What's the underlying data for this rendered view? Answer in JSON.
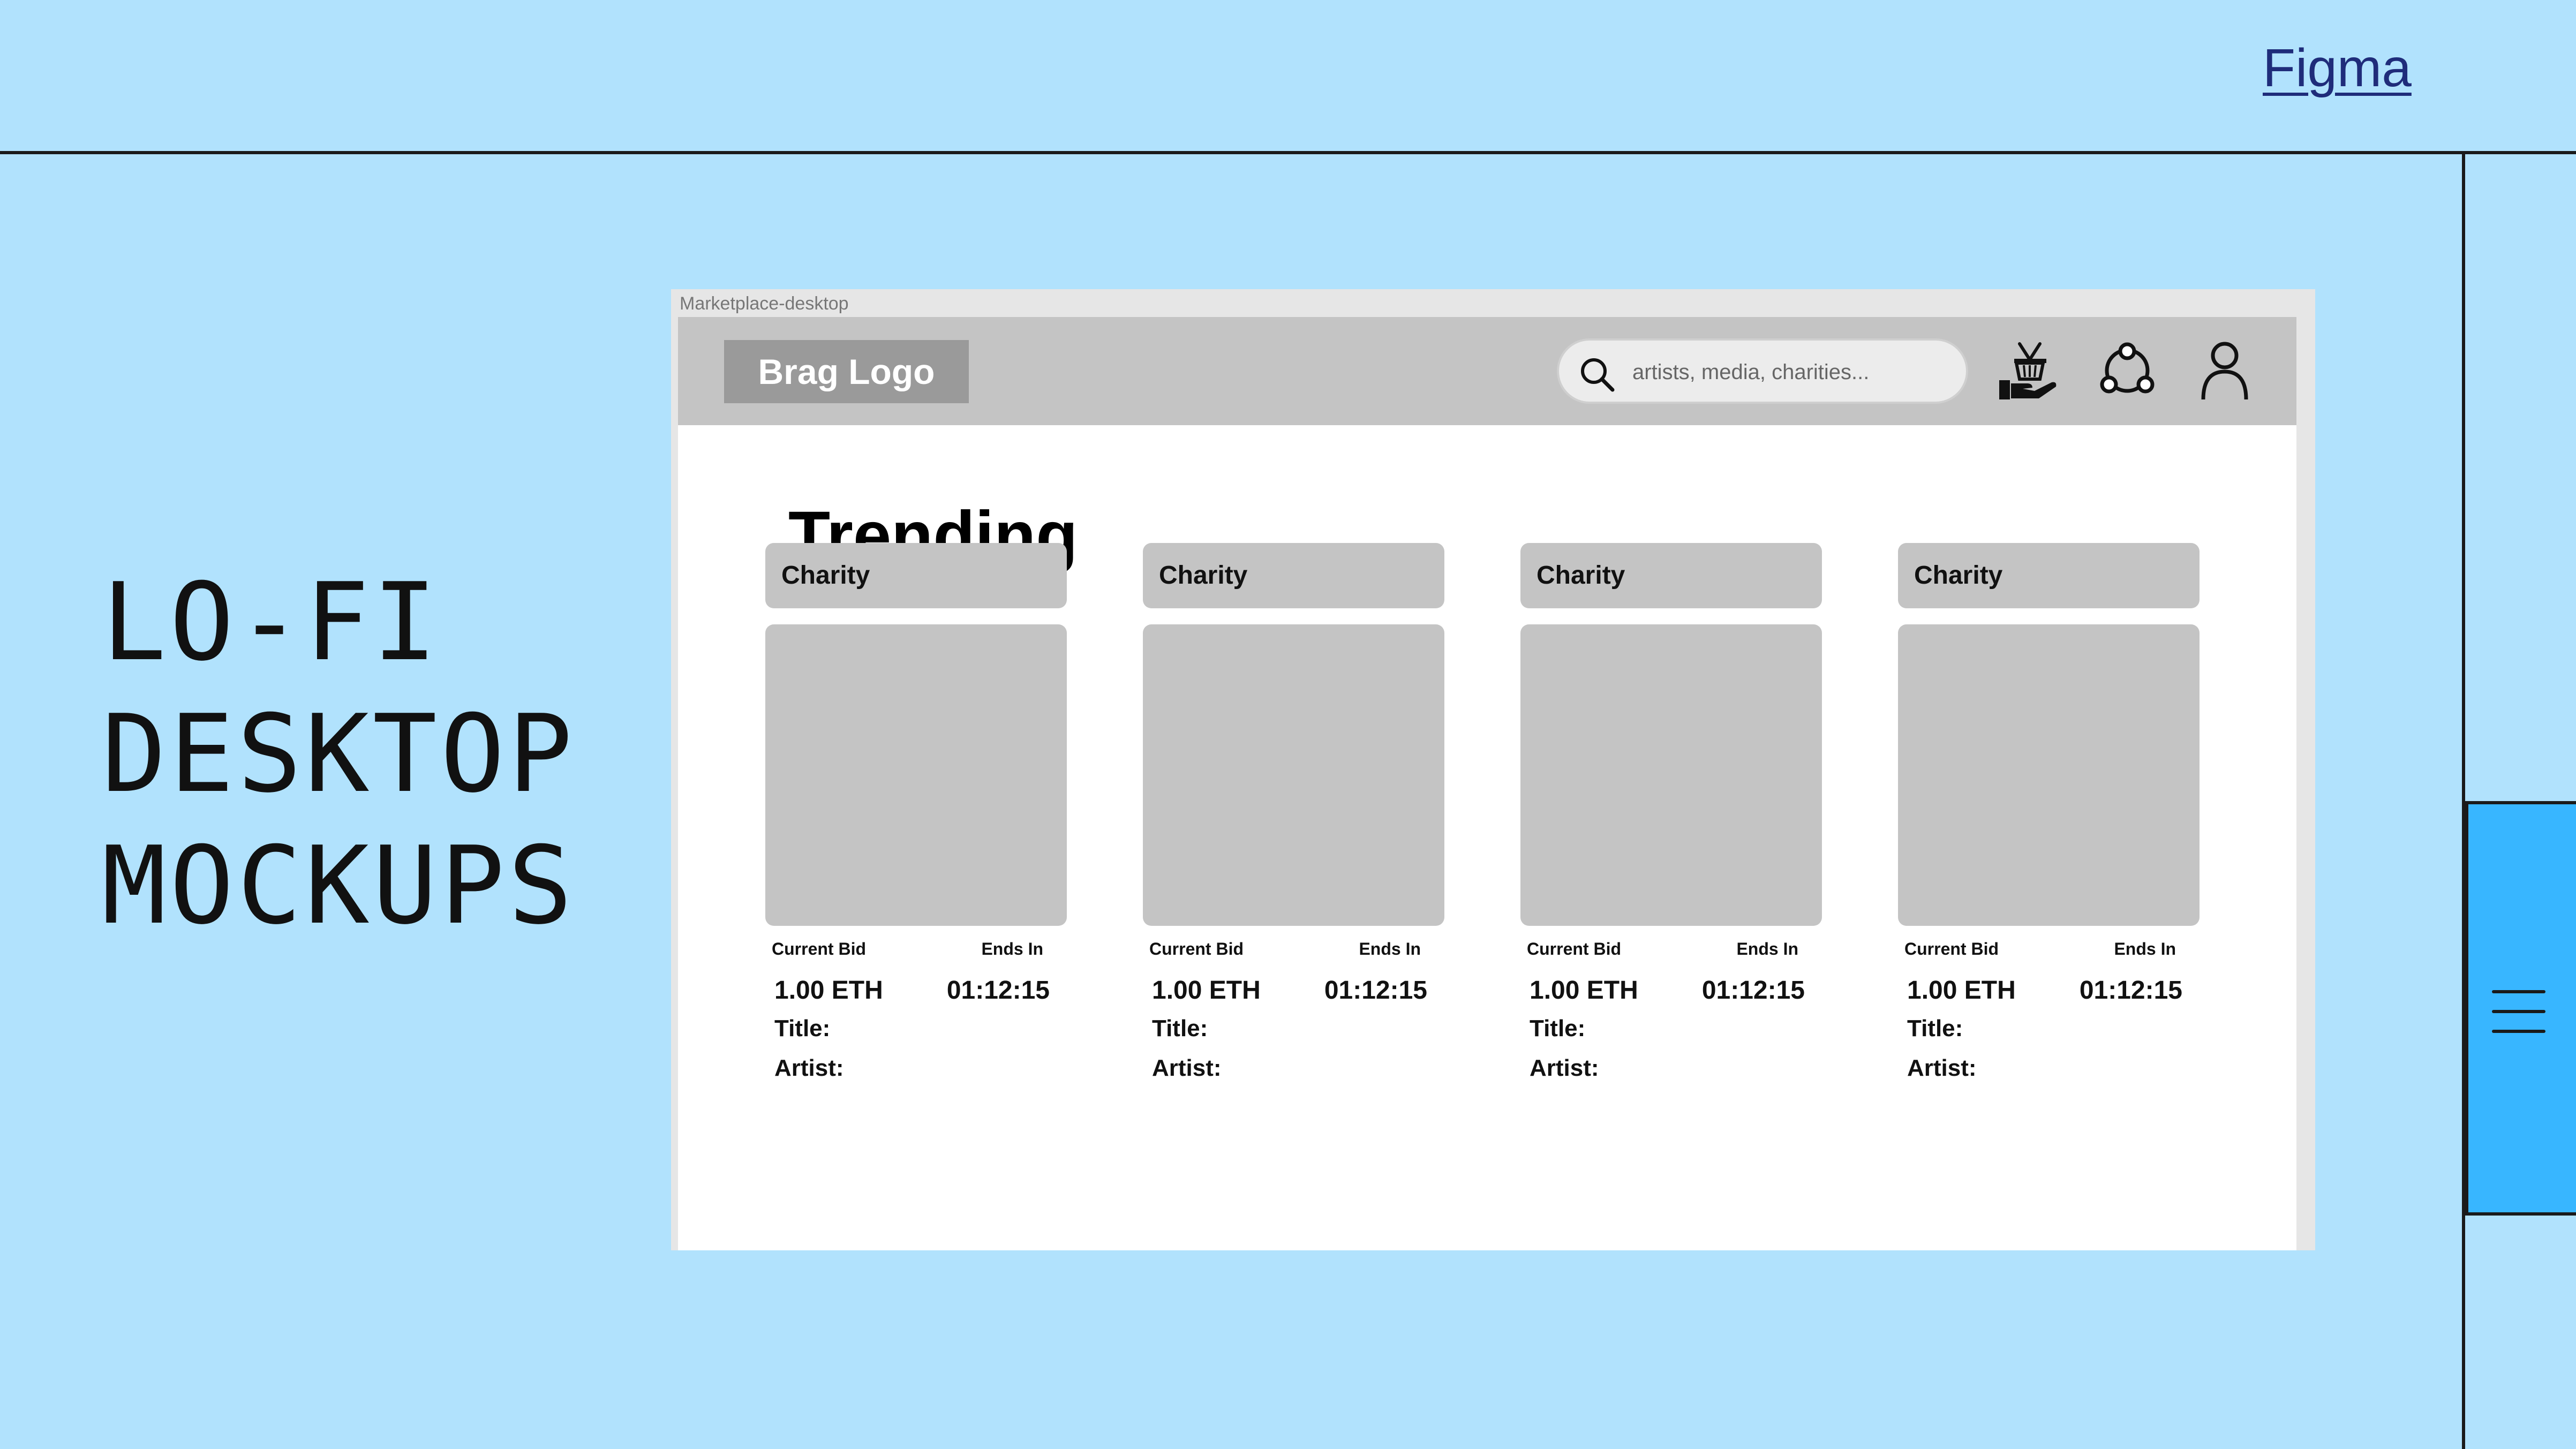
{
  "header": {
    "figma_link": "Figma"
  },
  "headline": {
    "lines": [
      "LO-FI",
      "DESKTOP",
      "MOCKUPS"
    ]
  },
  "frame": {
    "label": "Marketplace-desktop"
  },
  "navbar": {
    "logo": "Brag Logo",
    "search_placeholder": "artists, media, charities...",
    "icons": [
      "basket-hand-icon",
      "network-icon",
      "user-icon"
    ]
  },
  "trending": {
    "title": "Trending",
    "cards": [
      {
        "tag": "Charity",
        "bid_label": "Current Bid",
        "ends_label": "Ends In",
        "bid": "1.00 ETH",
        "time": "01:12:15",
        "title_label": "Title:",
        "artist_label": "Artist:"
      },
      {
        "tag": "Charity",
        "bid_label": "Current Bid",
        "ends_label": "Ends In",
        "bid": "1.00 ETH",
        "time": "01:12:15",
        "title_label": "Title:",
        "artist_label": "Artist:"
      },
      {
        "tag": "Charity",
        "bid_label": "Current Bid",
        "ends_label": "Ends In",
        "bid": "1.00 ETH",
        "time": "01:12:15",
        "title_label": "Title:",
        "artist_label": "Artist:"
      },
      {
        "tag": "Charity",
        "bid_label": "Current Bid",
        "ends_label": "Ends In",
        "bid": "1.00 ETH",
        "time": "01:12:15",
        "title_label": "Title:",
        "artist_label": "Artist:"
      }
    ]
  },
  "colors": {
    "page_bg": "#b1e2fd",
    "menu_tab": "#38b6ff",
    "wire_gray": "#c4c4c4"
  }
}
